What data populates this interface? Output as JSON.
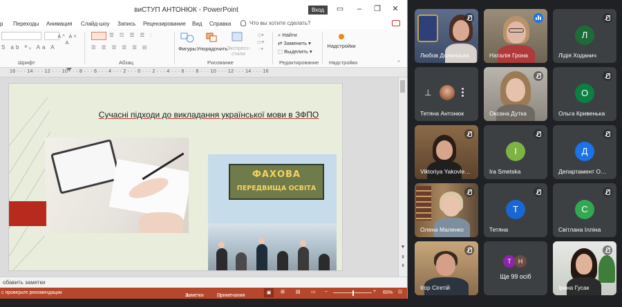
{
  "ppt": {
    "title": "виСТУП АНТОНЮК  -  PowerPoint",
    "signin": "Вход",
    "menu": [
      "р",
      "Переходы",
      "Анимация",
      "Слайд-шоу",
      "Запись",
      "Рецензирование",
      "Вид",
      "Справка"
    ],
    "tell_me": "Что вы хотите сделать?",
    "groups": {
      "font": "Шрифт",
      "paragraph": "Абзац",
      "drawing": "Рисование",
      "editing": "Редактирование"
    },
    "ribbon": {
      "shapes": "Фигуры",
      "arrange": "Упорядочить",
      "quick_styles": "Экспресс-стили",
      "find": "Найти",
      "replace": "Заменить",
      "select": "Выделить",
      "addins": "Надстройки"
    },
    "ruler": "16 · · · 14 · · · 12 · · · 10 · · · 8 · · · 6 · · · 4 · · · 2 · · · 0 · · · 2 · · · 4 · · · 6 · · · 8 · · · 10 · · · 12 · · · 14 · · · 16",
    "slide": {
      "title": "Сучасні підходи до викладання української мови в ЗФПО",
      "board_line1": "ФАХОВА",
      "board_line2": "ПЕРЕДВИЩА ОСВІТА"
    },
    "notes_placeholder": "обавить заметки",
    "status": {
      "left": "с проверьте рекомендации",
      "notes": "Заметки",
      "comments": "Примечания",
      "zoom": "65%"
    }
  },
  "meet": {
    "more_people": "Ще 99 осіб",
    "participants": [
      {
        "name": "Любов Долинська",
        "type": "video",
        "muted": true
      },
      {
        "name": "Наталія Грона",
        "type": "video",
        "speaking": true
      },
      {
        "name": "Лідія Ходанич",
        "type": "avatar",
        "initial": "Л",
        "color": "#1e6b3a",
        "muted": true
      },
      {
        "name": "Тетяна Антонюк",
        "type": "pinned"
      },
      {
        "name": "Оксана Дутка",
        "type": "video",
        "muted": true
      },
      {
        "name": "Ольга Кривенька",
        "type": "avatar",
        "initial": "О",
        "color": "#0b8043",
        "muted": true
      },
      {
        "name": "Viktoriya Yakovle…",
        "type": "video",
        "muted": true
      },
      {
        "name": "Ira Smetska",
        "type": "avatar",
        "initial": "I",
        "color": "#7cb342",
        "muted": true
      },
      {
        "name": "Департамент О…",
        "type": "avatar",
        "initial": "Д",
        "color": "#1a73e8",
        "muted": true
      },
      {
        "name": "Олена Маленко",
        "type": "video",
        "muted": true
      },
      {
        "name": "Тетяна",
        "type": "avatar",
        "initial": "Т",
        "color": "#1967d2",
        "muted": true
      },
      {
        "name": "Світлана Ілліна",
        "type": "avatar",
        "initial": "С",
        "color": "#33a852",
        "muted": true
      },
      {
        "name": "Ігор Сігетій",
        "type": "video",
        "muted": true
      },
      {
        "name": "more",
        "type": "more",
        "initials": [
          "Т",
          "Н"
        ]
      },
      {
        "name": "Ірина Гусак",
        "type": "video",
        "muted": true
      }
    ]
  }
}
